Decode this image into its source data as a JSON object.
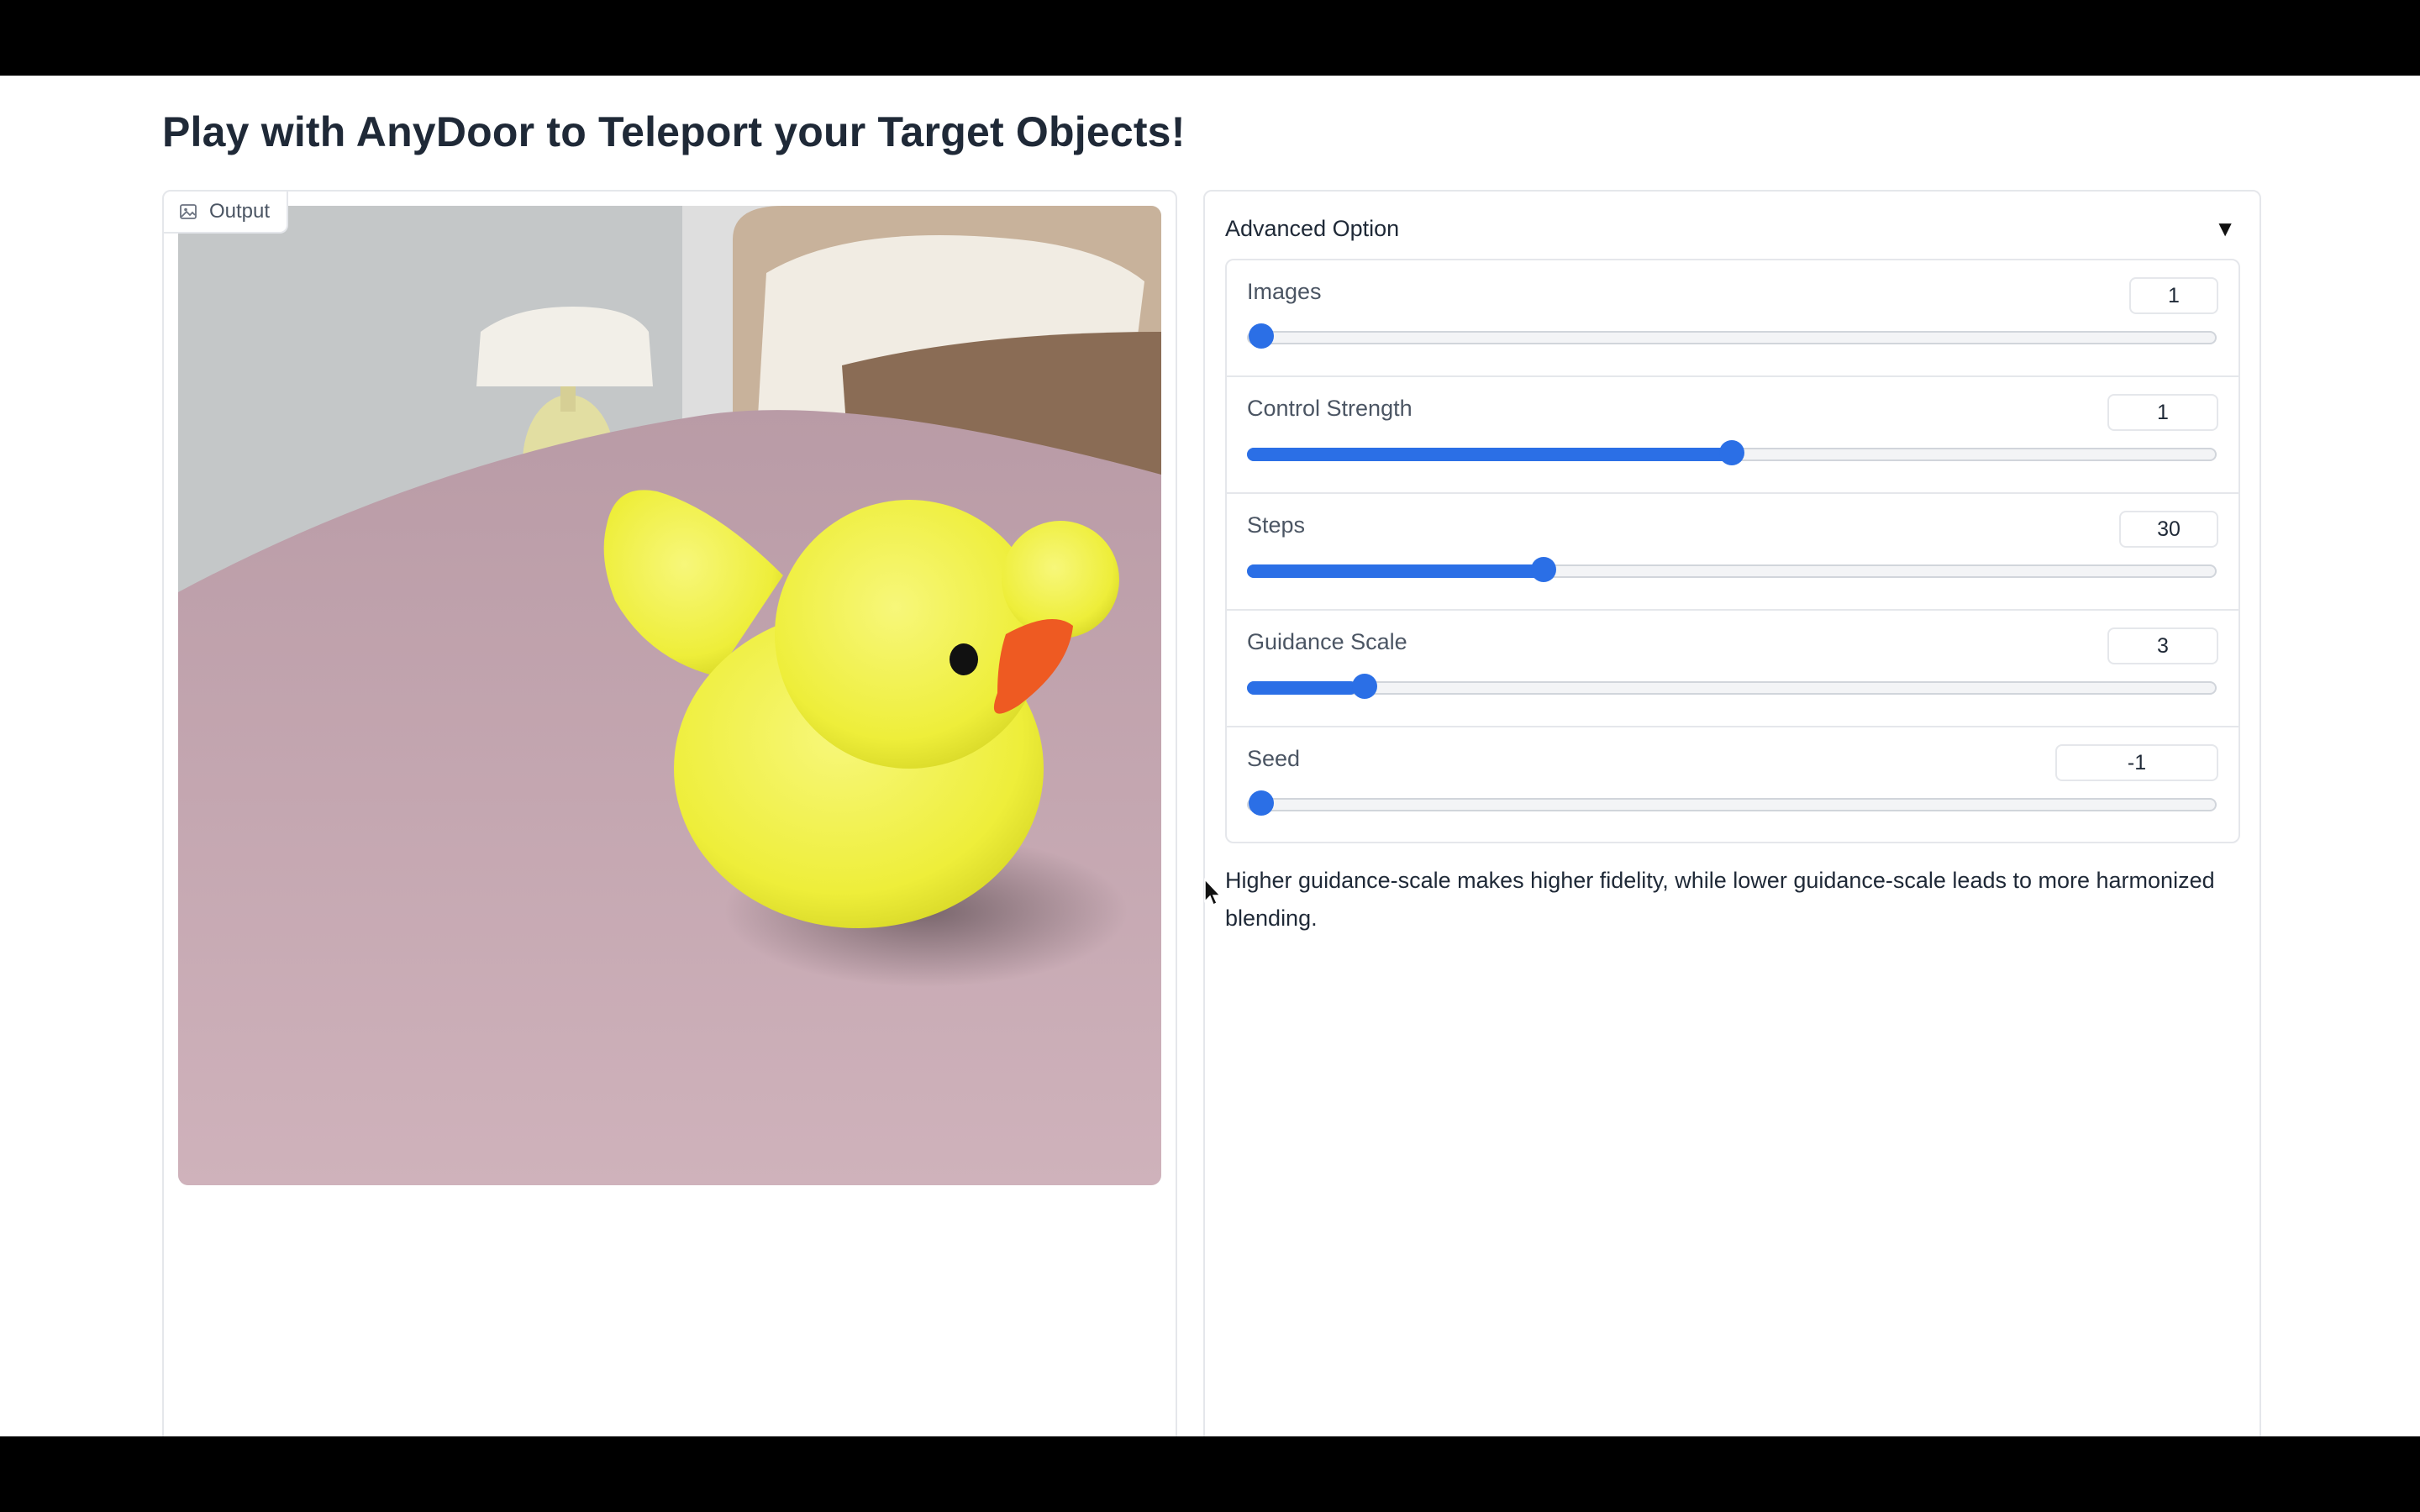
{
  "page": {
    "title": "Play with AnyDoor to Teleport your Target Objects!"
  },
  "output": {
    "label": "Output",
    "icon": "image-icon",
    "image_icon": "output-image"
  },
  "advanced": {
    "header": "Advanced Option",
    "toggle_icon": "triangle-down-icon",
    "sliders": [
      {
        "label": "Images",
        "value": "1",
        "fraction": 0.0
      },
      {
        "label": "Control Strength",
        "value": "1",
        "fraction": 0.5
      },
      {
        "label": "Steps",
        "value": "30",
        "fraction": 0.3
      },
      {
        "label": "Guidance Scale",
        "value": "3",
        "fraction": 0.11
      },
      {
        "label": "Seed",
        "value": "-1",
        "fraction": 0.0
      }
    ],
    "note": "Higher guidance-scale makes higher fidelity, while lower guidance-scale leads to more harmonized blending."
  },
  "colors": {
    "accent": "#2b6fe6",
    "border": "#e5e7eb"
  }
}
